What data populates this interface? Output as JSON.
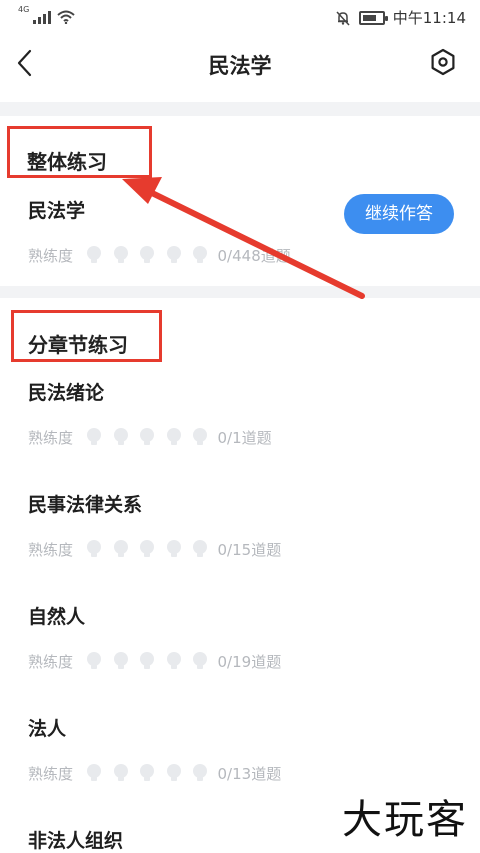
{
  "status_bar": {
    "network": "4G",
    "time": "中午11:14"
  },
  "header": {
    "title": "民法学"
  },
  "overall": {
    "section_title": "整体练习",
    "item": {
      "title": "民法学",
      "label": "熟练度",
      "count": "0/448道题",
      "button_label": "继续作答"
    }
  },
  "chapters": {
    "section_title": "分章节练习",
    "items": [
      {
        "title": "民法绪论",
        "label": "熟练度",
        "count": "0/1道题"
      },
      {
        "title": "民事法律关系",
        "label": "熟练度",
        "count": "0/15道题"
      },
      {
        "title": "自然人",
        "label": "熟练度",
        "count": "0/19道题"
      },
      {
        "title": "法人",
        "label": "熟练度",
        "count": "0/13道题"
      },
      {
        "title": "非法人组织"
      }
    ]
  },
  "watermark": "大玩客",
  "colors": {
    "accent": "#3d8ef0",
    "annotation": "#e63b2e",
    "muted": "#b5b8bd"
  }
}
